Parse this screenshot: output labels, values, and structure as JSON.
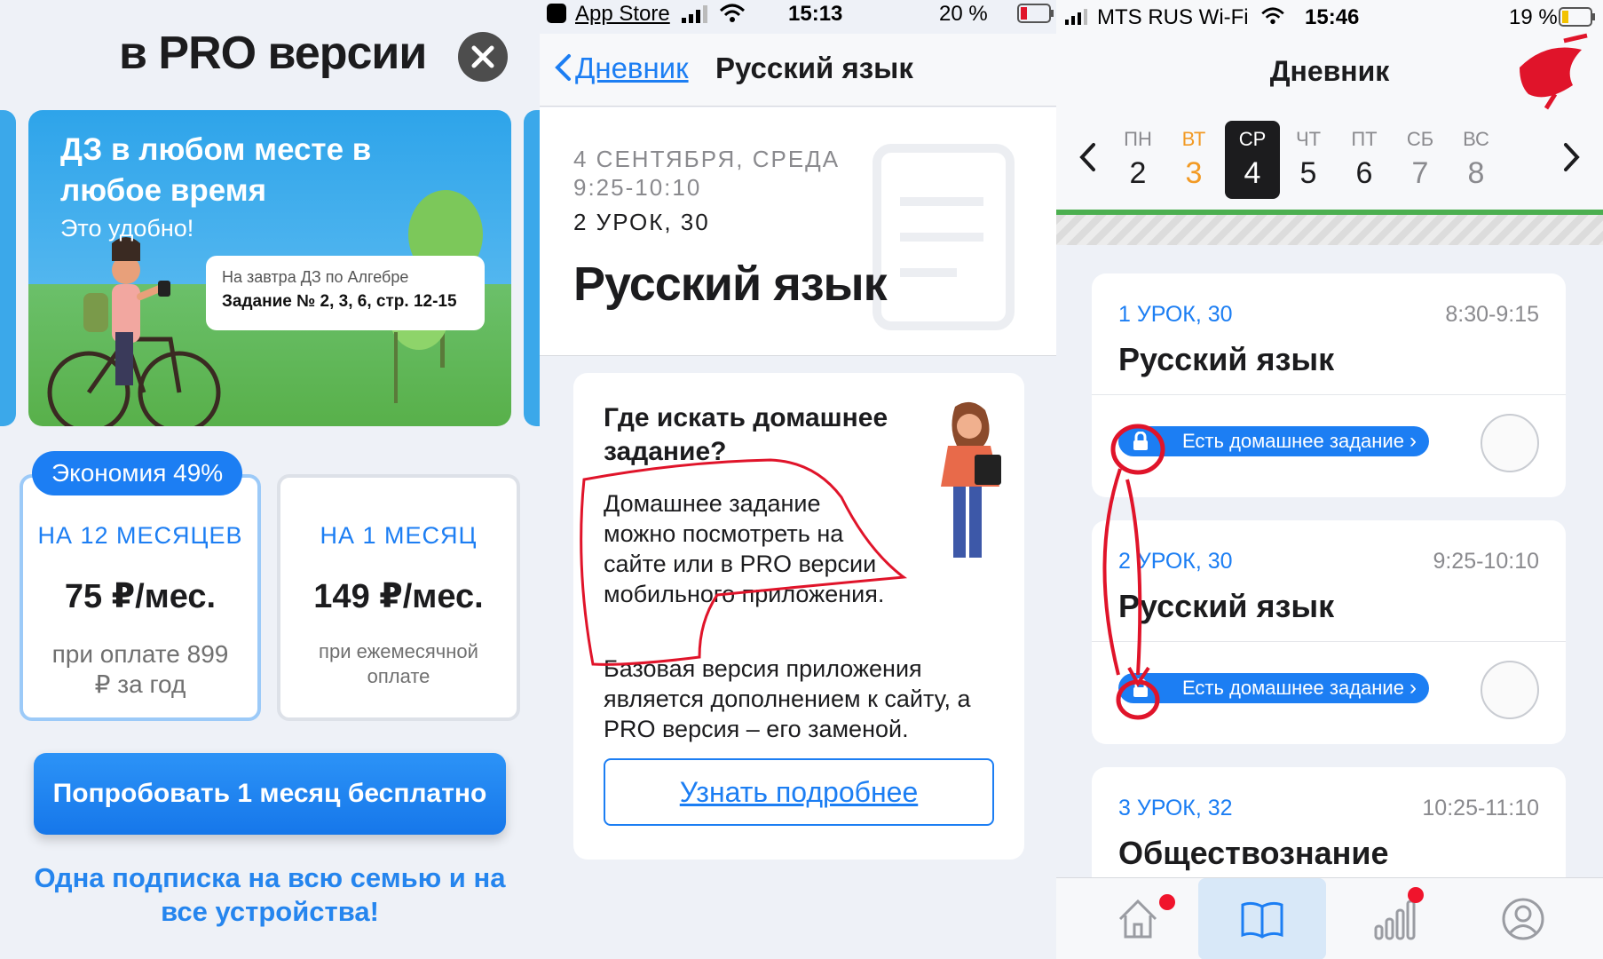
{
  "left": {
    "title": "в PRO версии",
    "promo": {
      "heading": "ДЗ в любом месте в любое время",
      "subheading": "Это удобно!",
      "bubble_line1": "На завтра ДЗ по Алгебре",
      "bubble_line2": "Задание № 2, 3, 6, стр. 12-15"
    },
    "savings_badge": "Экономия 49%",
    "plans": [
      {
        "name": "НА 12 МЕСЯЦЕВ",
        "price": "75 ₽/мес.",
        "note": "при оплате 899 ₽ за год"
      },
      {
        "name": "НА 1 МЕСЯЦ",
        "price": "149 ₽/мес.",
        "note": "при ежемесячной оплате"
      }
    ],
    "cta": "Попробовать 1 месяц бесплатно",
    "footer": "Одна подписка на всю семью и на все устройства!"
  },
  "middle": {
    "status": {
      "carrier": "App Store",
      "time": "15:13",
      "battery": "20 %"
    },
    "nav": {
      "back": "Дневник",
      "title": "Русский язык"
    },
    "header": {
      "date": "4 СЕНТЯБРЯ, СРЕДА",
      "time": "9:25-10:10",
      "lesson": "2 УРОК, 30",
      "subject": "Русский язык"
    },
    "card": {
      "heading": "Где искать домашнее задание?",
      "p1": "Домашнее задание можно посмотреть на сайте или в PRO версии мобильного приложения.",
      "p2": "Базовая версия приложения является дополнением к сайту, а PRO версия – его заменой.",
      "more": "Узнать подробнее"
    }
  },
  "right": {
    "status": {
      "carrier": "MTS RUS Wi-Fi",
      "time": "15:46",
      "battery": "19 %"
    },
    "title": "Дневник",
    "week": [
      {
        "name": "ПН",
        "date": "2"
      },
      {
        "name": "ВТ",
        "date": "3"
      },
      {
        "name": "СР",
        "date": "4"
      },
      {
        "name": "ЧТ",
        "date": "5"
      },
      {
        "name": "ПТ",
        "date": "6"
      },
      {
        "name": "СБ",
        "date": "7"
      },
      {
        "name": "ВС",
        "date": "8"
      }
    ],
    "lessons": [
      {
        "num": "1 УРОК, 30",
        "time": "8:30-9:15",
        "subject": "Русский язык",
        "hw": "Есть домашнее задание"
      },
      {
        "num": "2 УРОК, 30",
        "time": "9:25-10:10",
        "subject": "Русский язык",
        "hw": "Есть домашнее задание"
      },
      {
        "num": "3 УРОК, 32",
        "time": "10:25-11:10",
        "subject": "Обществознание"
      }
    ]
  },
  "colors": {
    "accent": "#1c7ef3",
    "tuesday": "#f29a24",
    "annotation": "#e0142a",
    "notification": "#f0142c"
  }
}
